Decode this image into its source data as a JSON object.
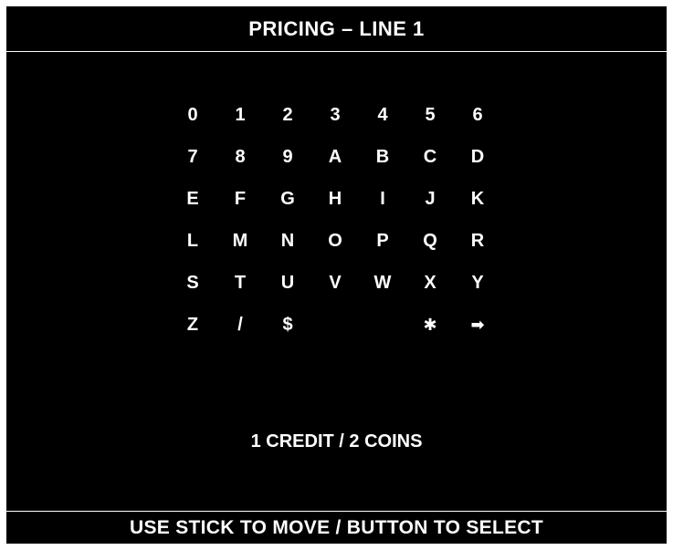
{
  "header": {
    "title": "PRICING – LINE 1"
  },
  "grid": {
    "rows": [
      [
        "0",
        "1",
        "2",
        "3",
        "4",
        "5",
        "6"
      ],
      [
        "7",
        "8",
        "9",
        "A",
        "B",
        "C",
        "D"
      ],
      [
        "E",
        "F",
        "G",
        "H",
        "I",
        "J",
        "K"
      ],
      [
        "L",
        "M",
        "N",
        "O",
        "P",
        "Q",
        "R"
      ],
      [
        "S",
        "T",
        "U",
        "V",
        "W",
        "X",
        "Y"
      ],
      [
        "Z",
        "/",
        "$",
        " ",
        " ",
        "✱",
        "➡"
      ]
    ],
    "special_icons": {
      "asterisk": "asterisk-icon",
      "arrow": "arrow-right-icon"
    }
  },
  "pricing": {
    "value": "1 CREDIT / 2 COINS"
  },
  "footer": {
    "instruction": "USE STICK TO MOVE / BUTTON TO SELECT"
  },
  "colors": {
    "background": "#000000",
    "text": "#ffffff",
    "frame": "#ffffff"
  }
}
